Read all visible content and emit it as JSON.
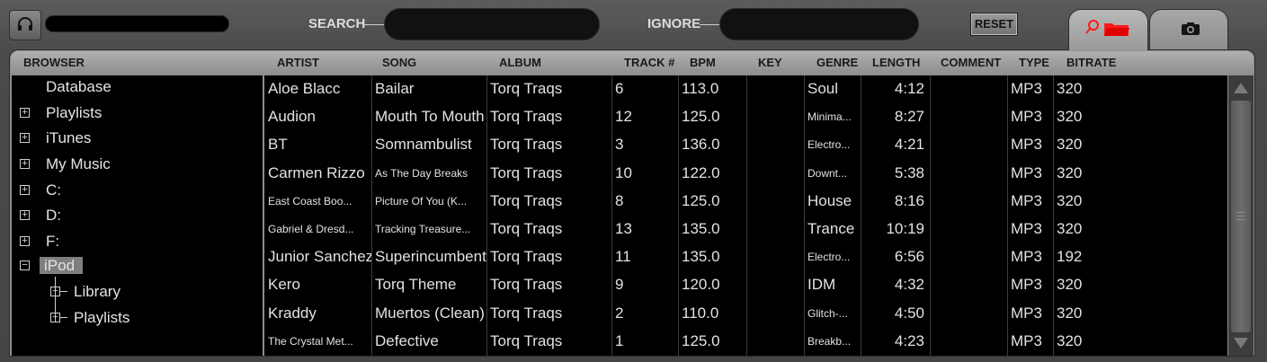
{
  "topbar": {
    "search_label": "SEARCH",
    "search_value": "",
    "ignore_label": "IGNORE",
    "ignore_value": "",
    "reset_label": "RESET"
  },
  "icons": {
    "headphones": "headphones-icon",
    "browse_tab": "search-folder-icon",
    "snapshot_tab": "camera-icon"
  },
  "colors": {
    "accent": "#ff1a1a",
    "panel_bg": "#000000",
    "text": "#e2e2e2"
  },
  "browser": {
    "header": "BROWSER",
    "items": [
      {
        "label": "Database",
        "expander": ""
      },
      {
        "label": "Playlists",
        "expander": "+"
      },
      {
        "label": "iTunes",
        "expander": "+"
      },
      {
        "label": "My Music",
        "expander": "+"
      },
      {
        "label": "C:",
        "expander": "+"
      },
      {
        "label": "D:",
        "expander": "+"
      },
      {
        "label": "F:",
        "expander": "+"
      },
      {
        "label": "iPod",
        "expander": "−"
      },
      {
        "label": "Library",
        "expander": "+"
      },
      {
        "label": "Playlists",
        "expander": "+"
      }
    ]
  },
  "columns": [
    "ARTIST",
    "SONG",
    "ALBUM",
    "TRACK #",
    "BPM",
    "KEY",
    "GENRE",
    "LENGTH",
    "COMMENT",
    "TYPE",
    "BITRATE"
  ],
  "tracks": [
    {
      "artist": "Aloe Blacc",
      "song": "Bailar",
      "album": "Torq Traqs",
      "track": "6",
      "bpm": "113.0",
      "key": "",
      "genre": "Soul",
      "length": "4:12",
      "comment": "",
      "type": "MP3",
      "bitrate": "320"
    },
    {
      "artist": "Audion",
      "song": "Mouth To Mouth",
      "album": "Torq Traqs",
      "track": "12",
      "bpm": "125.0",
      "key": "",
      "genre": "Minima...",
      "length": "8:27",
      "comment": "",
      "type": "MP3",
      "bitrate": "320"
    },
    {
      "artist": "BT",
      "song": "Somnambulist",
      "album": "Torq Traqs",
      "track": "3",
      "bpm": "136.0",
      "key": "",
      "genre": "Electro...",
      "length": "4:21",
      "comment": "",
      "type": "MP3",
      "bitrate": "320"
    },
    {
      "artist": "Carmen Rizzo",
      "song": "As The Day Breaks",
      "album": "Torq Traqs",
      "track": "10",
      "bpm": "122.0",
      "key": "",
      "genre": "Downt...",
      "length": "5:38",
      "comment": "",
      "type": "MP3",
      "bitrate": "320"
    },
    {
      "artist": "East Coast Boo...",
      "song": "Picture Of You (K...",
      "album": "Torq Traqs",
      "track": "8",
      "bpm": "125.0",
      "key": "",
      "genre": "House",
      "length": "8:16",
      "comment": "",
      "type": "MP3",
      "bitrate": "320"
    },
    {
      "artist": "Gabriel & Dresd...",
      "song": "Tracking Treasure...",
      "album": "Torq Traqs",
      "track": "13",
      "bpm": "135.0",
      "key": "",
      "genre": "Trance",
      "length": "10:19",
      "comment": "",
      "type": "MP3",
      "bitrate": "320"
    },
    {
      "artist": "Junior Sanchez",
      "song": "Superincumbent",
      "album": "Torq Traqs",
      "track": "11",
      "bpm": "135.0",
      "key": "",
      "genre": "Electro...",
      "length": "6:56",
      "comment": "",
      "type": "MP3",
      "bitrate": "192"
    },
    {
      "artist": "Kero",
      "song": "Torq Theme",
      "album": "Torq Traqs",
      "track": "9",
      "bpm": "120.0",
      "key": "",
      "genre": "IDM",
      "length": "4:32",
      "comment": "",
      "type": "MP3",
      "bitrate": "320"
    },
    {
      "artist": "Kraddy",
      "song": "Muertos (Clean)",
      "album": "Torq Traqs",
      "track": "2",
      "bpm": "110.0",
      "key": "",
      "genre": "Glitch-...",
      "length": "4:50",
      "comment": "",
      "type": "MP3",
      "bitrate": "320"
    },
    {
      "artist": "The Crystal Met...",
      "song": "Defective",
      "album": "Torq Traqs",
      "track": "1",
      "bpm": "125.0",
      "key": "",
      "genre": "Breakb...",
      "length": "4:23",
      "comment": "",
      "type": "MP3",
      "bitrate": "320"
    }
  ]
}
